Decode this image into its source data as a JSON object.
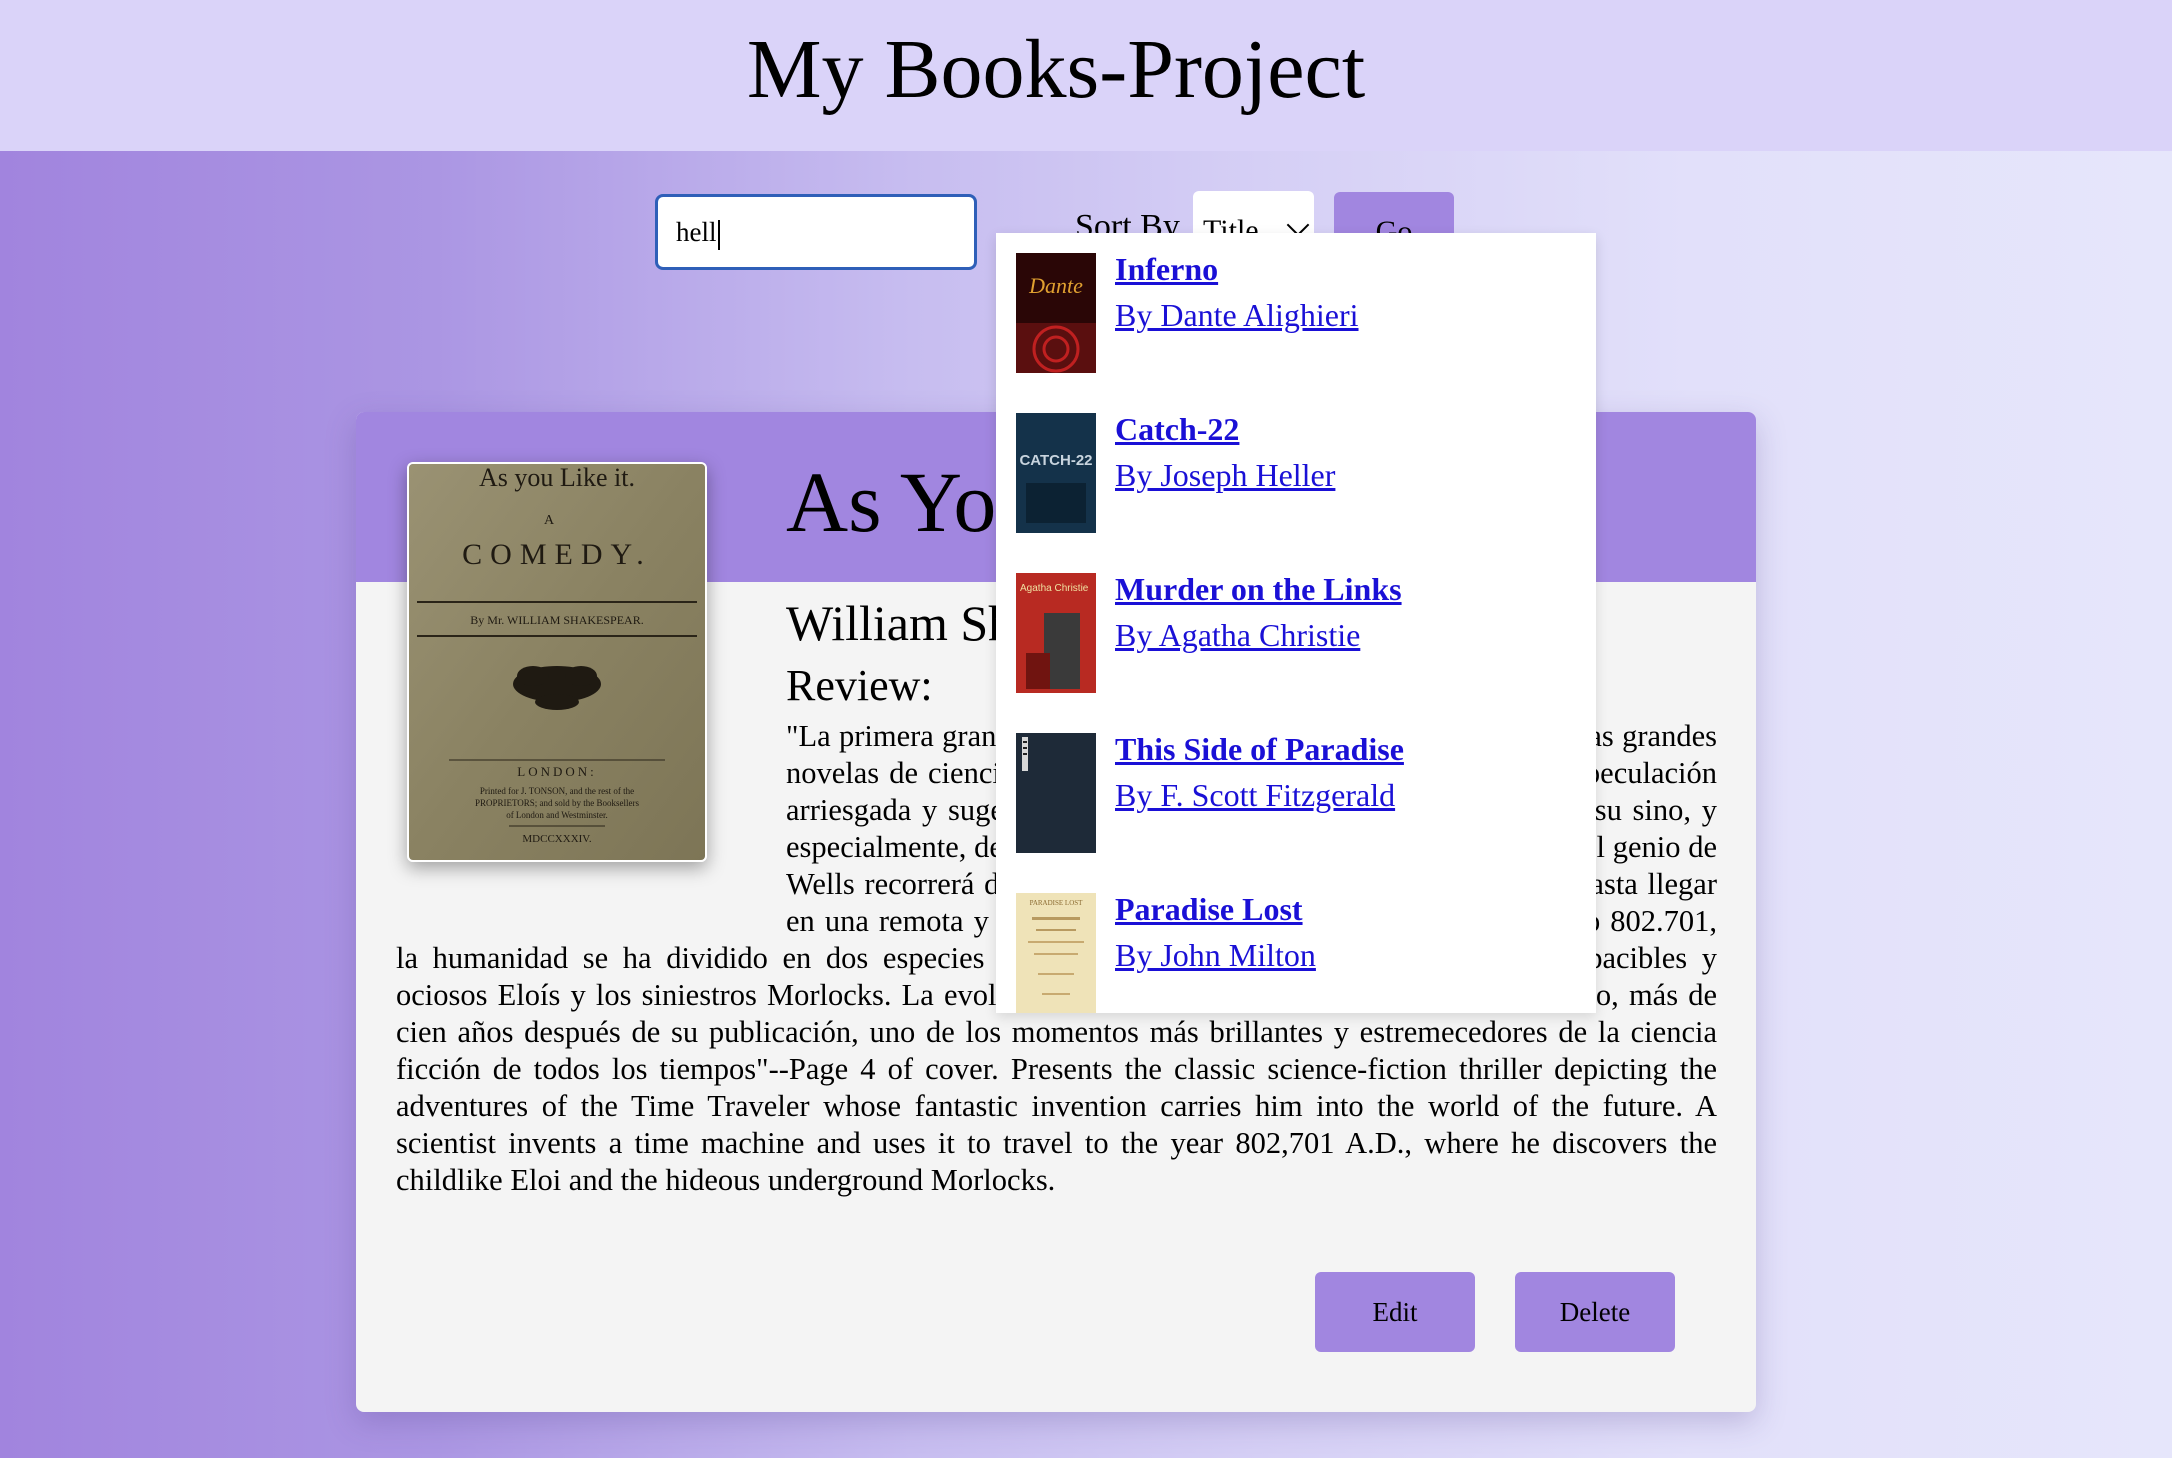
{
  "header": {
    "title": "My Books-Project"
  },
  "search": {
    "value": "hell"
  },
  "sort": {
    "label": "Sort By",
    "selected": "Title"
  },
  "go_label": "Go",
  "book": {
    "cover_lines": [
      "As you Like it.",
      "A",
      "COMEDY.",
      "By Mr. WILLIAM SHAKESPEAR.",
      "LONDON:",
      "Printed for J. TONSON, and the rest of the PROPRIETORS; and sold by the Booksellers of London and Westminster.",
      "MDCCXXXIV."
    ],
    "title": "As You Like It",
    "author": "William Shakespeare",
    "review_label": "Review:",
    "review_text": "\"La primera gran obra de H. G. Wells, escrita en 1895, y una de las grandes novelas de ciencia ficción de todos los tiempos. Un relato de especulación arriesgada y sugestiva en la que el autor nos habla del hombre, su sino, y especialmente, de su futuro. La máquina del tiempo que imagina el genio de Wells recorrerá distintas épocas en la historia de la humanidad hasta llegar en una remota y aparentemente idílica sociedad futura. En el año 802.701, la humanidad se ha dividido en dos especies tan antagónicas como complementarias: los apacibles y ociosos Eloís y los siniestros Morlocks. La evolución social que plantea esta novela sigue siendo, más de cien años después de su publicación, uno de los momentos más brillantes y estremecedores de la ciencia ficción de todos los tiempos\"--Page 4 of cover. Presents the classic science-fiction thriller depicting the adventures of the Time Traveler whose fantastic invention carries him into the world of the future. A scientist invents a time machine and uses it to travel to the year 802,701 A.D., where he discovers the childlike Eloi and the hideous underground Morlocks.",
    "edit_label": "Edit",
    "delete_label": "Delete"
  },
  "results": [
    {
      "title": "Inferno",
      "author": "By Dante Alighieri",
      "thumb_text": "Dante"
    },
    {
      "title": "Catch-22",
      "author": "By Joseph Heller",
      "thumb_text": "CATCH-22"
    },
    {
      "title": "Murder on the Links",
      "author": "By Agatha Christie",
      "thumb_text": "Agatha Christie"
    },
    {
      "title": "This Side of Paradise",
      "author": "By F. Scott Fitzgerald",
      "thumb_text": ""
    },
    {
      "title": "Paradise Lost",
      "author": "By John Milton",
      "thumb_text": "PARADISE LOST"
    }
  ]
}
